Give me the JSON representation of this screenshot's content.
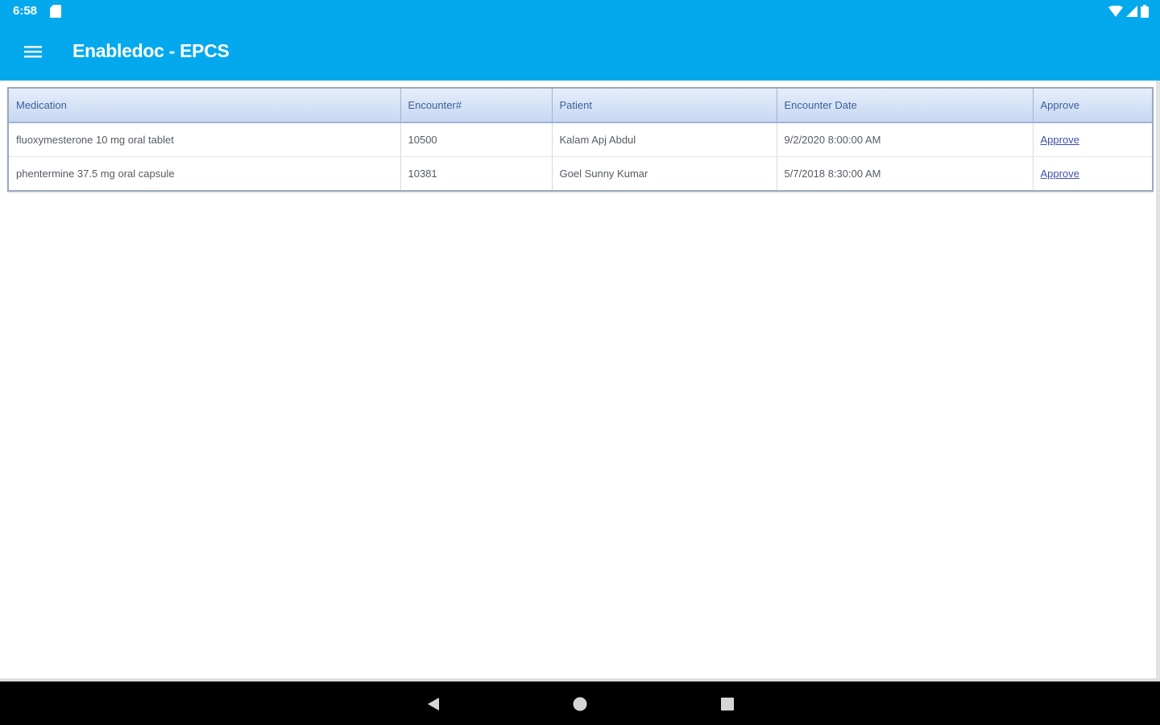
{
  "status_bar": {
    "time": "6:58"
  },
  "app_bar": {
    "title": "Enabledoc - EPCS"
  },
  "table": {
    "columns": [
      "Medication",
      "Encounter#",
      "Patient",
      "Encounter Date",
      "Approve"
    ],
    "rows": [
      {
        "medication": "fluoxymesterone 10 mg oral tablet",
        "encounter": "10500",
        "patient": "Kalam Apj Abdul",
        "date": "9/2/2020 8:00:00 AM",
        "action": "Approve"
      },
      {
        "medication": "phentermine 37.5 mg oral capsule",
        "encounter": "10381",
        "patient": "Goel Sunny Kumar",
        "date": "5/7/2018 8:30:00 AM",
        "action": "Approve"
      }
    ]
  },
  "colors": {
    "app_bar": "#03a9ec",
    "header_text": "#3d5f9e",
    "link": "#3e4fa8"
  }
}
